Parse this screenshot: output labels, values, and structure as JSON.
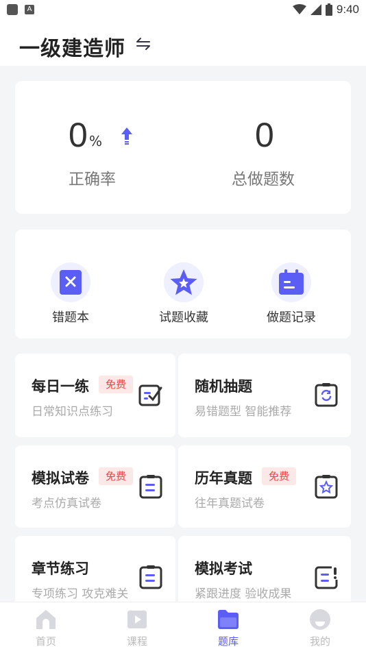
{
  "status": {
    "time": "9:40",
    "a_label": "A"
  },
  "header": {
    "title": "一级建造师"
  },
  "stats": {
    "accuracy_value": "0",
    "accuracy_unit": "%",
    "accuracy_label": "正确率",
    "total_value": "0",
    "total_label": "总做题数"
  },
  "quick_actions": [
    {
      "label": "错题本",
      "icon": "wrong-book-icon"
    },
    {
      "label": "试题收藏",
      "icon": "star-icon"
    },
    {
      "label": "做题记录",
      "icon": "calendar-icon"
    }
  ],
  "tiles": [
    {
      "title": "每日一练",
      "subtitle": "日常知识点练习",
      "badge": "免费",
      "icon": "check-doc-icon"
    },
    {
      "title": "随机抽题",
      "subtitle": "易错题型 智能推荐",
      "badge": "",
      "icon": "refresh-doc-icon"
    },
    {
      "title": "模拟试卷",
      "subtitle": "考点仿真试卷",
      "badge": "免费",
      "icon": "doc-icon"
    },
    {
      "title": "历年真题",
      "subtitle": "往年真题试卷",
      "badge": "免费",
      "icon": "star-doc-icon"
    },
    {
      "title": "章节练习",
      "subtitle": "专项练习 攻克难关",
      "badge": "",
      "icon": "doc-icon"
    },
    {
      "title": "模拟考试",
      "subtitle": "紧跟进度 验收成果",
      "badge": "",
      "icon": "alert-doc-icon"
    }
  ],
  "tabbar": [
    {
      "label": "首页",
      "active": false
    },
    {
      "label": "课程",
      "active": false
    },
    {
      "label": "题库",
      "active": true
    },
    {
      "label": "我的",
      "active": false
    }
  ],
  "colors": {
    "accent": "#5b5ef5",
    "badge_bg": "#fde8e8",
    "badge_text": "#e44"
  }
}
